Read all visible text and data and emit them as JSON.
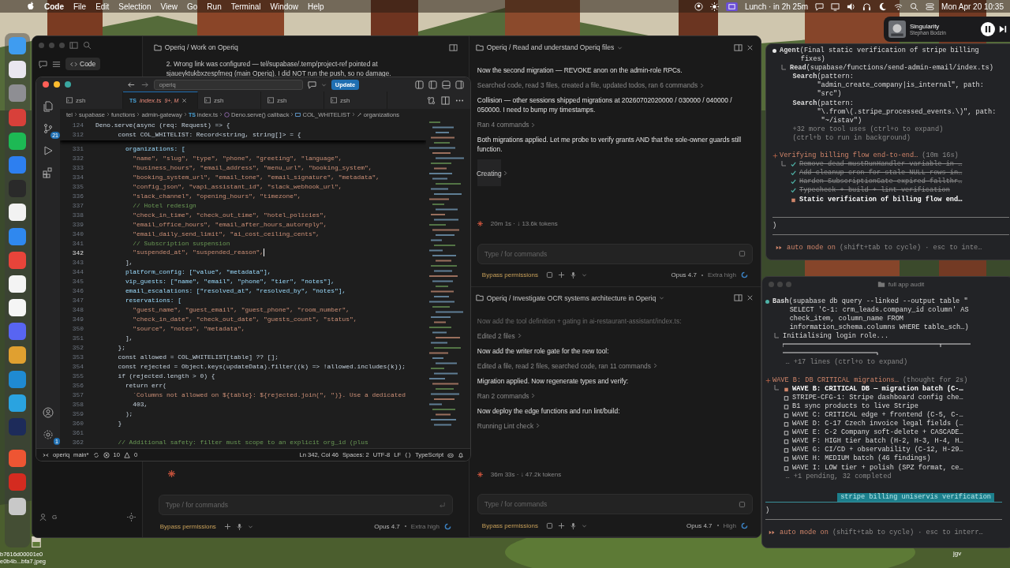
{
  "menu_bar": {
    "app": "Code",
    "menus": [
      "File",
      "Edit",
      "Selection",
      "View",
      "Go",
      "Run",
      "Terminal",
      "Window",
      "Help"
    ],
    "event": "Lunch · in 2h 25m",
    "clock": "Mon Apr 20 10:35"
  },
  "now_playing": {
    "title": "Singularity",
    "artist": "Stephan Bodzin"
  },
  "dock": [
    {
      "color": "#3f9cf0"
    },
    {
      "color": "#e9e6ef"
    },
    {
      "color": "#8e8e93"
    },
    {
      "color": "#d8403a"
    },
    {
      "color": "#1db954"
    },
    {
      "color": "#2d7ff0"
    },
    {
      "color": "#2a2a2a"
    },
    {
      "color": "#f2f2f2"
    },
    {
      "color": "#2f88ef"
    },
    {
      "color": "#e8443a"
    },
    {
      "color": "#f4f4f4"
    },
    {
      "color": "#f5f5f5"
    },
    {
      "color": "#5865f2"
    },
    {
      "color": "#e0a030"
    },
    {
      "color": "#1f8ad2"
    },
    {
      "color": "#2aa3e0"
    },
    {
      "color": "#1d2b5a"
    },
    {
      "color": "#ee5533"
    },
    {
      "color": "#d42b20"
    },
    {
      "color": "#c8c8c8"
    }
  ],
  "desktop_files": [
    "b7616d00001e0",
    "e0b4b...bfa7.jpeg"
  ],
  "desktop_label": "jgv",
  "assistant_app": {
    "sidebar": {
      "mode_button": "Code",
      "user_initial": "G"
    },
    "main_pane": {
      "title": "Operiq / Work on Operiq",
      "message": "2. Wrong link was configured — tel/supabase/.temp/project-ref pointed at sjaueyktukbxzespfmeg (main Operiq). I did NOT run the push, so no damage.",
      "input_placeholder": "Type / for commands",
      "permissions": "Bypass permissions",
      "model": "Opus 4.7",
      "effort": "Extra high"
    },
    "panes": [
      {
        "title": "Operiq / Read and understand Operiq files",
        "messages": [
          {
            "kind": "text",
            "text": "Now the second migration — REVOKE anon on the admin-role RPCs."
          },
          {
            "kind": "tool",
            "text": "Searched code, read 3 files, created a file, updated todos, ran 6 commands"
          },
          {
            "kind": "text",
            "text": "Collision — other sessions shipped migrations at 20260702020000 / 030000 / 040000 / 050000. I need to bump my timestamps."
          },
          {
            "kind": "tool",
            "text": "Ran 4 commands"
          },
          {
            "kind": "text",
            "text": "Both migrations applied. Let me probe to verify grants AND that the sole-owner guards still function."
          },
          {
            "kind": "active",
            "text": "Creating"
          }
        ],
        "stats": "20m 1s · ↓ 13.6k tokens",
        "input_placeholder": "Type / for commands",
        "permissions": "Bypass permissions",
        "model": "Opus 4.7",
        "effort": "Extra high"
      },
      {
        "title": "Operiq / Investigate OCR systems architecture in Operiq",
        "messages": [
          {
            "kind": "faded",
            "text": "Now add the tool definition + gating in ai-restaurant-assistant/index.ts:"
          },
          {
            "kind": "tool",
            "text": "Edited 2 files"
          },
          {
            "kind": "text",
            "text": "Now add the writer role gate for the new tool:"
          },
          {
            "kind": "tool",
            "text": "Edited a file, read 2 files, searched code, ran 11 commands"
          },
          {
            "kind": "text",
            "text": "Migration applied. Now regenerate types and verify:"
          },
          {
            "kind": "tool",
            "text": "Ran 2 commands"
          },
          {
            "kind": "text",
            "text": "Now deploy the edge functions and run lint/build:"
          },
          {
            "kind": "tool",
            "text": "Running Lint check"
          }
        ],
        "stats": "36m 33s · ↓ 47.2k tokens",
        "input_placeholder": "Type / for commands",
        "permissions": "Bypass permissions",
        "model": "Opus 4.7",
        "effort": "High"
      }
    ]
  },
  "editor": {
    "search": "operiq",
    "update_button": "Update",
    "tabs": [
      {
        "kind": "terminal",
        "label": "zsh",
        "selected": false
      },
      {
        "kind": "file",
        "icon_text": "TS",
        "label": "index.ts",
        "badge": "9+, M",
        "selected": true
      },
      {
        "kind": "terminal",
        "label": "zsh",
        "selected": false
      },
      {
        "kind": "terminal",
        "label": "zsh",
        "selected": false
      },
      {
        "kind": "terminal",
        "label": "zsh",
        "selected": false
      }
    ],
    "breadcrumb": [
      {
        "kind": "folder",
        "label": "tel"
      },
      {
        "kind": "folder",
        "label": "supabase"
      },
      {
        "kind": "folder",
        "label": "functions"
      },
      {
        "kind": "folder",
        "label": "admin-gateway"
      },
      {
        "kind": "file",
        "icon_text": "TS",
        "label": "index.ts"
      },
      {
        "kind": "function",
        "label": "Deno.serve() callback"
      },
      {
        "kind": "variable",
        "label": "COL_WHITELIST"
      },
      {
        "kind": "property",
        "label": "organizations"
      }
    ],
    "source_control_badge": "21",
    "settings_badge": "1",
    "sticky_lines": [
      {
        "number": "124",
        "kind": "code",
        "text": "Deno.serve(async (req: Request) => {"
      },
      {
        "number": "312",
        "kind": "code",
        "text": "      const COL_WHITELIST: Record<string, string[]> = {"
      }
    ],
    "lines": [
      {
        "number": "331",
        "kind": "key",
        "current": false,
        "text": "        organizations: ["
      },
      {
        "number": "332",
        "kind": "strings",
        "current": false,
        "text": "          \"name\", \"slug\", \"type\", \"phone\", \"greeting\", \"language\","
      },
      {
        "number": "333",
        "kind": "strings",
        "current": false,
        "text": "          \"business_hours\", \"email_address\", \"menu_url\", \"booking_system\","
      },
      {
        "number": "334",
        "kind": "strings",
        "current": false,
        "text": "          \"booking_system_url\", \"email_tone\", \"email_signature\", \"metadata\","
      },
      {
        "number": "335",
        "kind": "strings",
        "current": false,
        "text": "          \"config_json\", \"vapi_assistant_id\", \"slack_webhook_url\","
      },
      {
        "number": "336",
        "kind": "strings",
        "current": false,
        "text": "          \"slack_channel\", \"opening_hours\", \"timezone\","
      },
      {
        "number": "337",
        "kind": "comment",
        "current": false,
        "text": "          // Hotel redesign"
      },
      {
        "number": "338",
        "kind": "strings",
        "current": false,
        "text": "          \"check_in_time\", \"check_out_time\", \"hotel_policies\","
      },
      {
        "number": "339",
        "kind": "strings",
        "current": false,
        "text": "          \"email_office_hours\", \"email_after_hours_autoreply\","
      },
      {
        "number": "340",
        "kind": "strings",
        "current": false,
        "text": "          \"email_daily_send_limit\", \"ai_cost_ceiling_cents\","
      },
      {
        "number": "341",
        "kind": "comment",
        "current": false,
        "text": "          // Subscription suspension"
      },
      {
        "number": "342",
        "kind": "strings",
        "current": true,
        "text": "          \"suspended_at\", \"suspended_reason\","
      },
      {
        "number": "343",
        "kind": "code",
        "current": false,
        "text": "        ],"
      },
      {
        "number": "344",
        "kind": "key",
        "current": false,
        "text": "        platform_config: [\"value\", \"metadata\"],"
      },
      {
        "number": "345",
        "kind": "key",
        "current": false,
        "text": "        vip_guests: [\"name\", \"email\", \"phone\", \"tier\", \"notes\"],"
      },
      {
        "number": "346",
        "kind": "key",
        "current": false,
        "text": "        email_escalations: [\"resolved_at\", \"resolved_by\", \"notes\"],"
      },
      {
        "number": "347",
        "kind": "key",
        "current": false,
        "text": "        reservations: ["
      },
      {
        "number": "348",
        "kind": "strings",
        "current": false,
        "text": "          \"guest_name\", \"guest_email\", \"guest_phone\", \"room_number\","
      },
      {
        "number": "349",
        "kind": "strings",
        "current": false,
        "text": "          \"check_in_date\", \"check_out_date\", \"guests_count\", \"status\","
      },
      {
        "number": "350",
        "kind": "strings",
        "current": false,
        "text": "          \"source\", \"notes\", \"metadata\","
      },
      {
        "number": "351",
        "kind": "code",
        "current": false,
        "text": "        ],"
      },
      {
        "number": "352",
        "kind": "code",
        "current": false,
        "text": "      };"
      },
      {
        "number": "353",
        "kind": "code",
        "current": false,
        "text": "      const allowed = COL_WHITELIST[table] ?? [];"
      },
      {
        "number": "354",
        "kind": "code",
        "current": false,
        "text": "      const rejected = Object.keys(updateData).filter((k) => !allowed.includes(k));"
      },
      {
        "number": "355",
        "kind": "code",
        "current": false,
        "text": "      if (rejected.length > 0) {"
      },
      {
        "number": "356",
        "kind": "code",
        "current": false,
        "text": "        return err("
      },
      {
        "number": "357",
        "kind": "strings",
        "current": false,
        "text": "          `Columns not allowed on ${table}: ${rejected.join(\", \")}. Use a dedicated"
      },
      {
        "number": "358",
        "kind": "code",
        "current": false,
        "text": "          403,"
      },
      {
        "number": "359",
        "kind": "code",
        "current": false,
        "text": "        );"
      },
      {
        "number": "360",
        "kind": "code",
        "current": false,
        "text": "      }"
      },
      {
        "number": "361",
        "kind": "blank",
        "current": false
      },
      {
        "number": "362",
        "kind": "comment",
        "current": false,
        "text": "      // Additional safety: filter must scope to an explicit org_id (plus"
      }
    ],
    "status": {
      "folder": "operiq",
      "branch": "main*",
      "errors": "10",
      "warnings": "0",
      "position": "Ln 342, Col 46",
      "spaces": "Spaces: 2",
      "encoding": "UTF-8",
      "eol": "LF",
      "language": "TypeScript"
    }
  },
  "top_terminal": {
    "lines": [
      {
        "kind": "call",
        "color": "#e6e6e6",
        "text": "**Agent**(Final static verification of stripe billing"
      },
      {
        "kind": "cont",
        "text": "     fixes)"
      },
      {
        "kind": "branch",
        "text": "**Read**(supabase/functions/send-admin-email/index.ts)"
      },
      {
        "kind": "cont",
        "text": "   **Search**(pattern:"
      },
      {
        "kind": "cont",
        "text": "         \"admin_create_company|is_internal\", path:"
      },
      {
        "kind": "cont",
        "text": "         \"src\")"
      },
      {
        "kind": "cont",
        "text": "   **Search**(pattern:"
      },
      {
        "kind": "cont",
        "text": "         \"\\.from\\(.stripe_processed_events.\\)\", path:"
      },
      {
        "kind": "cont",
        "text": "          \"~/istav\")"
      },
      {
        "kind": "dim",
        "text": "   +32 more tool uses (ctrl+o to expand)"
      },
      {
        "kind": "dim",
        "text": "   (ctrl+b to run in background)"
      },
      {
        "kind": "blank"
      },
      {
        "kind": "task",
        "text": "Verifying billing flow end-to-end…",
        "note": "(10m 16s)"
      },
      {
        "kind": "done",
        "branch": true,
        "text": "Remove dead mustRunHandler variable in …"
      },
      {
        "kind": "done",
        "branch": false,
        "text": "Add cleanup cron for stale NULL rows in…"
      },
      {
        "kind": "done",
        "branch": false,
        "text": "Harden SubscriptionGate expired fallthr…"
      },
      {
        "kind": "done",
        "branch": false,
        "text": "Typecheck + build + lint verification"
      },
      {
        "kind": "current",
        "branch": false,
        "text": "Static verification of billing flow end…"
      },
      {
        "kind": "blank"
      },
      {
        "kind": "rule"
      },
      {
        "kind": "close",
        "text": ")"
      },
      {
        "kind": "rule"
      },
      {
        "kind": "mode",
        "text": "auto mode on",
        "note": "(shift+tab to cycle) · esc to inte…"
      }
    ]
  },
  "audit_terminal": {
    "title": "full app audit",
    "lines": [
      {
        "kind": "call",
        "color": "#4fb3a8",
        "text": "**Bash**(supabase db query --linked --output table \""
      },
      {
        "kind": "cont",
        "text": "    SELECT 'C-1: crm_leads.company_id column' AS"
      },
      {
        "kind": "cont",
        "text": "    check_item, column_name FROM"
      },
      {
        "kind": "cont",
        "text": "    information_schema.columns WHERE table_sch…)"
      },
      {
        "kind": "branch",
        "text": "Initialising login role..."
      },
      {
        "kind": "progress"
      },
      {
        "kind": "dim",
        "text": "   … +17 lines (ctrl+o to expand)"
      },
      {
        "kind": "blank"
      },
      {
        "kind": "task",
        "text": "WAVE B: DB CRITICAL migrations…",
        "note": "(thought for 2s)"
      },
      {
        "kind": "current",
        "branch": true,
        "text": "WAVE B: CRITICAL DB — migration batch (C-…"
      },
      {
        "kind": "todo",
        "branch": false,
        "text": "STRIPE-CFG-1: Stripe dashboard config che…"
      },
      {
        "kind": "todo",
        "branch": false,
        "text": "B1 sync products to live Stripe"
      },
      {
        "kind": "todo",
        "branch": false,
        "text": "WAVE C: CRITICAL edge + frontend (C-5, C-…"
      },
      {
        "kind": "todo",
        "branch": false,
        "text": "WAVE D: C-17 Czech invoice legal fields (…"
      },
      {
        "kind": "todo",
        "branch": false,
        "text": "WAVE E: C-2 Company soft-delete + CASCADE…"
      },
      {
        "kind": "todo",
        "branch": false,
        "text": "WAVE F: HIGH tier batch (H-2, H-3, H-4, H…"
      },
      {
        "kind": "todo",
        "branch": false,
        "text": "WAVE G: CI/CD + observability (C-12, H-29…"
      },
      {
        "kind": "todo",
        "branch": false,
        "text": "WAVE H: MEDIUM batch (46 findings)"
      },
      {
        "kind": "todo",
        "branch": false,
        "text": "WAVE I: LOW tier + polish (SPZ format, ce…"
      },
      {
        "kind": "dim",
        "text": "   … +1 pending, 32 completed"
      },
      {
        "kind": "blank"
      },
      {
        "kind": "label",
        "text": "stripe billing uniservis verification"
      },
      {
        "kind": "close",
        "text": ")"
      },
      {
        "kind": "rule"
      },
      {
        "kind": "mode",
        "text": "auto mode on",
        "note": "(shift+tab to cycle) · esc to interr…"
      }
    ]
  }
}
